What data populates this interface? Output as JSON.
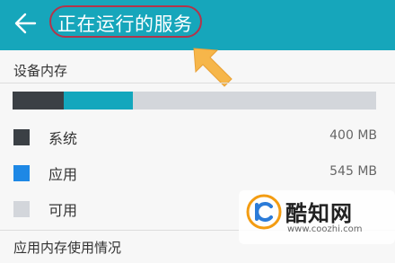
{
  "app_bar": {
    "title": "正在运行的服务",
    "back_icon": "arrow-left-icon",
    "background": "#16a6bb"
  },
  "device_memory": {
    "header": "设备内存",
    "usage_bar": {
      "system_fraction": 0.14,
      "apps_fraction": 0.19,
      "free_fraction": 0.67
    },
    "legend": [
      {
        "label": "系统",
        "value": "400 MB",
        "color": "#3b4045"
      },
      {
        "label": "应用",
        "value": "545 MB",
        "color": "#1e88e5"
      },
      {
        "label": "可用",
        "value": "",
        "color": "#d3d6db"
      }
    ]
  },
  "app_memory": {
    "header": "应用内存使用情况"
  },
  "annotation": {
    "highlight_color": "#b3344a",
    "arrow_color": "#f6b64a"
  },
  "watermark": {
    "brand": "酷知网",
    "url": "www.coozhi.com"
  }
}
